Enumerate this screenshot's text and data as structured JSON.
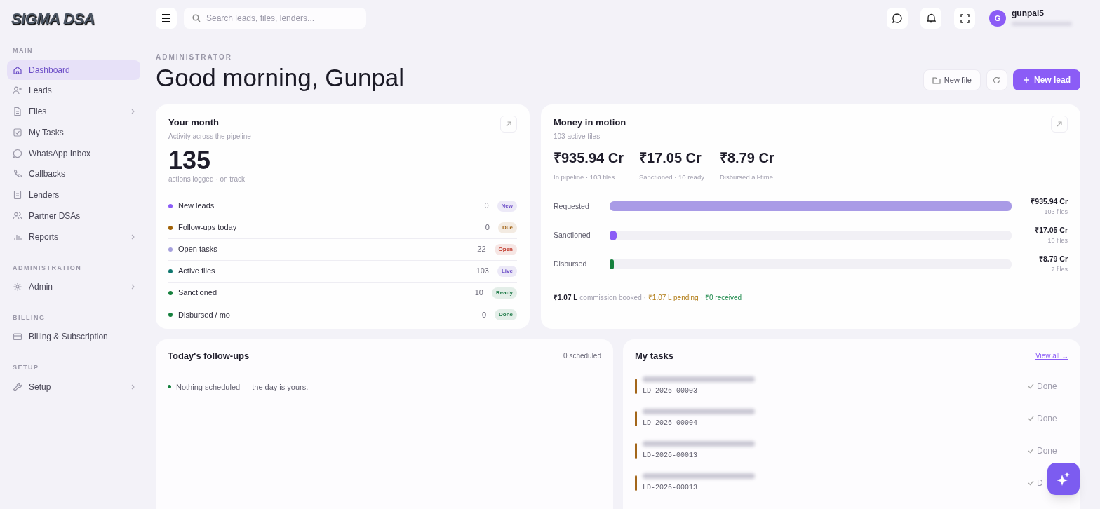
{
  "brand": {
    "logo": "SIGMA DSA"
  },
  "search": {
    "placeholder": "Search leads, files, lenders..."
  },
  "user": {
    "initial": "G",
    "name": "gunpal5"
  },
  "sidebar": {
    "sections": [
      {
        "title": "MAIN",
        "items": [
          {
            "label": "Dashboard",
            "selected": true,
            "expandable": false
          },
          {
            "label": "Leads",
            "selected": false,
            "expandable": false
          },
          {
            "label": "Files",
            "selected": false,
            "expandable": true
          },
          {
            "label": "My Tasks",
            "selected": false,
            "expandable": false
          },
          {
            "label": "WhatsApp Inbox",
            "selected": false,
            "expandable": false
          },
          {
            "label": "Callbacks",
            "selected": false,
            "expandable": false
          },
          {
            "label": "Lenders",
            "selected": false,
            "expandable": false
          },
          {
            "label": "Partner DSAs",
            "selected": false,
            "expandable": false
          },
          {
            "label": "Reports",
            "selected": false,
            "expandable": true
          }
        ]
      },
      {
        "title": "ADMINISTRATION",
        "items": [
          {
            "label": "Admin",
            "selected": false,
            "expandable": true
          }
        ]
      },
      {
        "title": "BILLING",
        "items": [
          {
            "label": "Billing & Subscription",
            "selected": false,
            "expandable": false
          }
        ]
      },
      {
        "title": "SETUP",
        "items": [
          {
            "label": "Setup",
            "selected": false,
            "expandable": true
          }
        ]
      }
    ]
  },
  "page": {
    "eyebrow": "ADMINISTRATOR",
    "greeting": "Good morning, Gunpal",
    "buttons": [
      {
        "label": "New file",
        "kind": "secondary"
      },
      {
        "kind": "refresh"
      },
      {
        "label": "New lead",
        "kind": "primary"
      }
    ]
  },
  "your_month": {
    "title": "Your month",
    "subtitle": "Activity across the pipeline",
    "total": "135",
    "caption": "actions logged · on track",
    "rows": [
      {
        "label": "New leads",
        "count": "0",
        "color": "#8b5cf6",
        "badge": {
          "text": "New",
          "color": "#6d4fc7"
        }
      },
      {
        "label": "Follow-ups today",
        "count": "0",
        "color": "#a16207",
        "badge": {
          "text": "Due",
          "color": "#a3661a"
        }
      },
      {
        "label": "Open tasks",
        "count": "22",
        "color": "#a5a0dc",
        "badge": {
          "text": "Open",
          "color": "#c0392b"
        }
      },
      {
        "label": "Active files",
        "count": "103",
        "color": "#0f766e",
        "badge": {
          "text": "Live",
          "color": "#6d4fc7"
        }
      },
      {
        "label": "Sanctioned",
        "count": "10",
        "color": "#15803d",
        "badge": {
          "text": "Ready",
          "color": "#1e7a47"
        }
      },
      {
        "label": "Disbursed / mo",
        "count": "0",
        "color": "#15803d",
        "badge": {
          "text": "Done",
          "color": "#1e7a47"
        }
      }
    ]
  },
  "money": {
    "title": "Money in motion",
    "subtitle": "103 active files",
    "stats": [
      {
        "value": "₹935.94 Cr",
        "caption": "In pipeline · 103 files"
      },
      {
        "value": "₹17.05 Cr",
        "caption": "Sanctioned · 10 ready"
      },
      {
        "value": "₹8.79 Cr",
        "caption": "Disbursed all-time"
      }
    ],
    "bars": [
      {
        "label": "Requested",
        "level": 1,
        "color": "#a99be6",
        "amount": "₹935.94 Cr",
        "files": "103 files"
      },
      {
        "label": "Sanctioned",
        "level": 0.018,
        "color": "#8b5cf6",
        "amount": "₹17.05 Cr",
        "files": "10 files"
      },
      {
        "label": "Disbursed",
        "level": 0.01,
        "color": "#15803d",
        "amount": "₹8.79 Cr",
        "files": "7 files"
      }
    ],
    "footer": [
      {
        "text": "₹1.07 L",
        "kind": "strong"
      },
      {
        "text": "commission booked ·",
        "kind": "muted"
      },
      {
        "text": "₹1.07 L pending",
        "kind": "pending"
      },
      {
        "text": "·",
        "kind": "muted"
      },
      {
        "text": "₹0 received",
        "kind": "received"
      }
    ]
  },
  "followups": {
    "title": "Today's follow-ups",
    "count": "0 scheduled",
    "empty": "Nothing scheduled — the day is yours."
  },
  "tasks": {
    "title": "My tasks",
    "link": "View all →",
    "items": [
      {
        "id": "LD-2026-00003",
        "action": "Done"
      },
      {
        "id": "LD-2026-00004",
        "action": "Done"
      },
      {
        "id": "LD-2026-00013",
        "action": "Done"
      },
      {
        "id": "LD-2026-00013",
        "action": "D"
      }
    ]
  }
}
